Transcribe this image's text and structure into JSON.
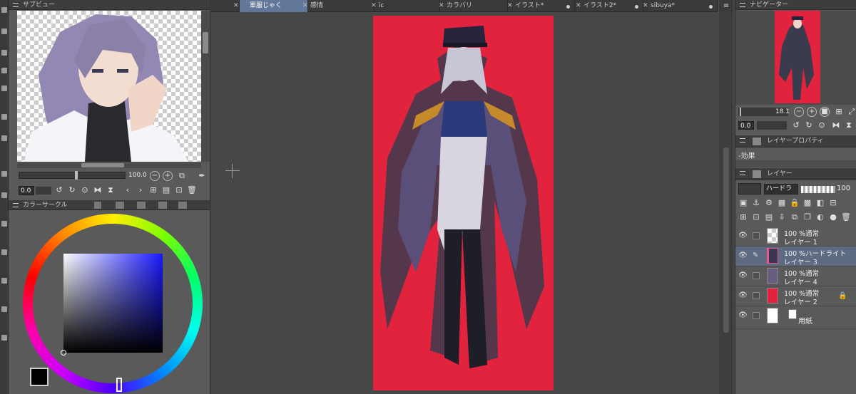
{
  "subview": {
    "title": "サブビュー",
    "zoom": "100.0",
    "angle": "0.0"
  },
  "color_wheel": {
    "title": "カラーサークル",
    "main_color": "#000000",
    "sub_color": "#b56c6a"
  },
  "tabs": [
    {
      "label": "軍服じゃく",
      "active": true,
      "modified": false
    },
    {
      "label": "感情",
      "active": false,
      "modified": false
    },
    {
      "label": "ic",
      "active": false,
      "modified": false
    },
    {
      "label": "カラバリ",
      "active": false,
      "modified": false
    },
    {
      "label": "イラスト*",
      "active": false,
      "modified": true
    },
    {
      "label": "イラスト2*",
      "active": false,
      "modified": true
    },
    {
      "label": "sibuya*",
      "active": false,
      "modified": true
    }
  ],
  "navigator": {
    "title": "ナビゲーター",
    "zoom": "18.1",
    "angle": "0.0"
  },
  "layer_property": {
    "title": "レイヤープロパティ",
    "effect_label": "-効果"
  },
  "layers_panel": {
    "title": "レイヤー",
    "blend_mode": "ハードラ",
    "opacity": "100",
    "layers": [
      {
        "mode": "100 %通常",
        "name": "レイヤー 1",
        "selected": false,
        "locked": false,
        "thumb_color": "#cfcfcf"
      },
      {
        "mode": "100 %ハードライト",
        "name": "レイヤー 3",
        "selected": true,
        "locked": false,
        "thumb_color": "#3a3550"
      },
      {
        "mode": "100 %通常",
        "name": "レイヤー 4",
        "selected": false,
        "locked": false,
        "thumb_color": "#6a5e80"
      },
      {
        "mode": "100 %通常",
        "name": "レイヤー 2",
        "selected": false,
        "locked": true,
        "thumb_color": "#e2233e"
      },
      {
        "mode": "",
        "name": "用紙",
        "selected": false,
        "locked": false,
        "thumb_color": "#ffffff"
      }
    ]
  },
  "canvas": {
    "background_color": "#e2233e"
  }
}
